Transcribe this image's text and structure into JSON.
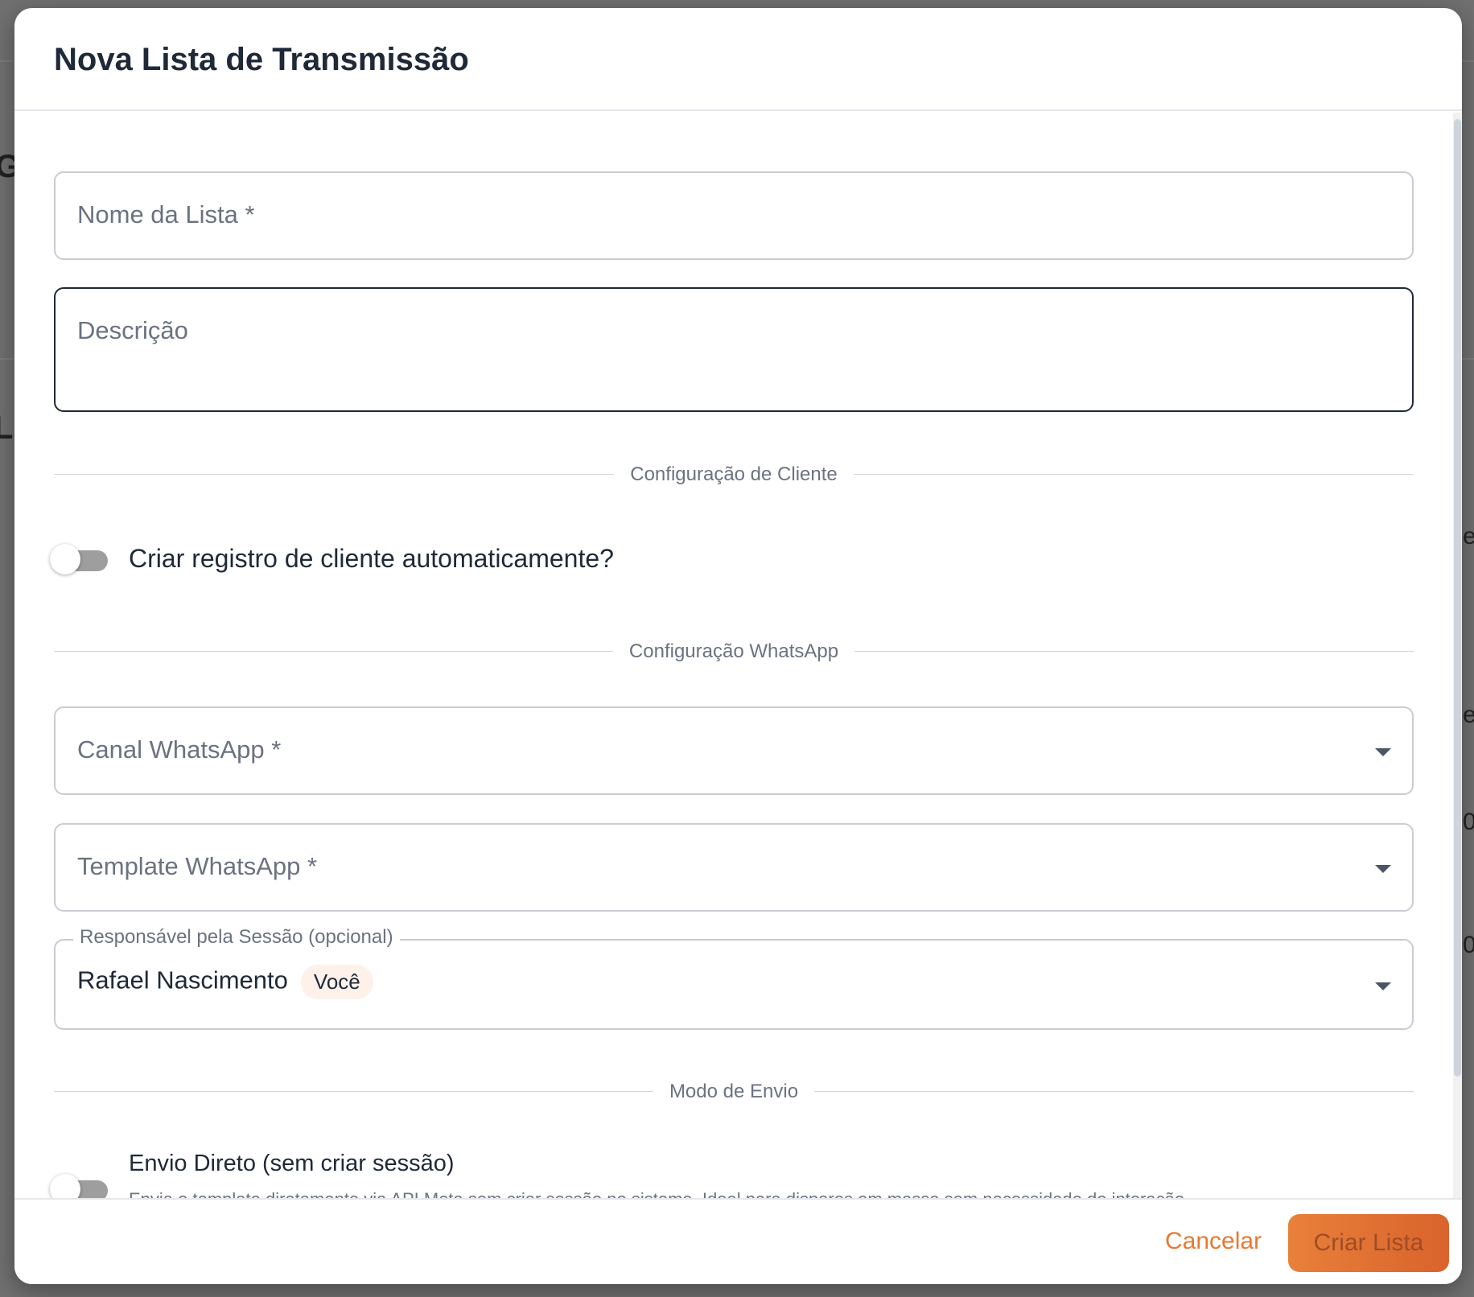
{
  "modal": {
    "title": "Nova Lista de Transmissão",
    "fields": {
      "name_placeholder": "Nome da Lista *",
      "description_placeholder": "Descrição",
      "channel_placeholder": "Canal WhatsApp *",
      "template_placeholder": "Template WhatsApp *",
      "owner_label": "Responsável pela Sessão (opcional)",
      "owner_value": "Rafael Nascimento",
      "owner_badge": "Você"
    },
    "sections": {
      "client": "Configuração de Cliente",
      "whatsapp": "Configuração WhatsApp",
      "send_mode": "Modo de Envio"
    },
    "toggles": {
      "auto_client_label": "Criar registro de cliente automaticamente?",
      "auto_client_on": false,
      "direct_send_label": "Envio Direto (sem criar sessão)",
      "direct_send_desc": "Envia o template diretamente via API Meta sem criar sessão no sistema. Ideal para disparos em massa sem necessidade de interação.",
      "direct_send_on": false
    },
    "footer": {
      "cancel": "Cancelar",
      "create": "Criar Lista"
    },
    "accent": "#e8792f"
  },
  "background": {
    "fragments": [
      "G",
      "Li",
      "e",
      "e",
      "0",
      "0"
    ]
  }
}
